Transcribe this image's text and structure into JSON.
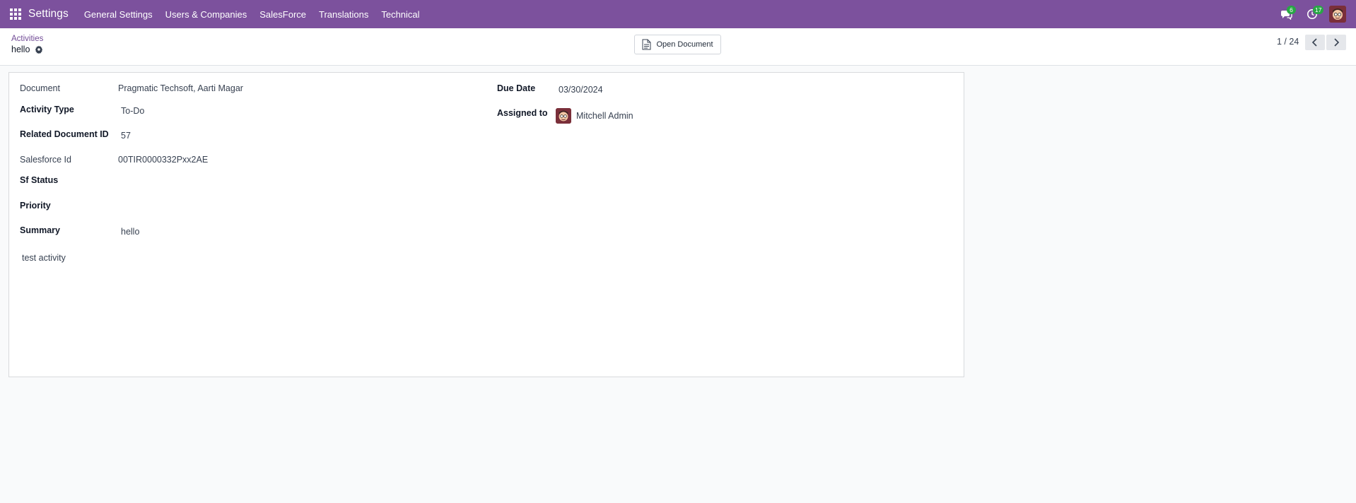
{
  "navbar": {
    "app_name": "Settings",
    "menu": [
      "General Settings",
      "Users & Companies",
      "SalesForce",
      "Translations",
      "Technical"
    ],
    "messages_count": "6",
    "activities_count": "17",
    "color": "#7c519d"
  },
  "control_panel": {
    "breadcrumb_parent": "Activities",
    "breadcrumb_current": "hello",
    "open_document_label": "Open Document",
    "pager": "1 / 24"
  },
  "form": {
    "document_label": "Document",
    "document_value": "Pragmatic Techsoft, Aarti Magar",
    "activity_type_label": "Activity Type",
    "activity_type_value": "To-Do",
    "related_doc_id_label": "Related Document ID",
    "related_doc_id_value": "57",
    "salesforce_id_label": "Salesforce Id",
    "salesforce_id_value": "00TIR0000332Pxx2AE",
    "sf_status_label": "Sf Status",
    "priority_label": "Priority",
    "summary_label": "Summary",
    "summary_value": "hello",
    "note": "test activity",
    "due_date_label": "Due Date",
    "due_date_value": "03/30/2024",
    "assigned_to_label": "Assigned to",
    "assigned_to_value": "Mitchell Admin"
  }
}
